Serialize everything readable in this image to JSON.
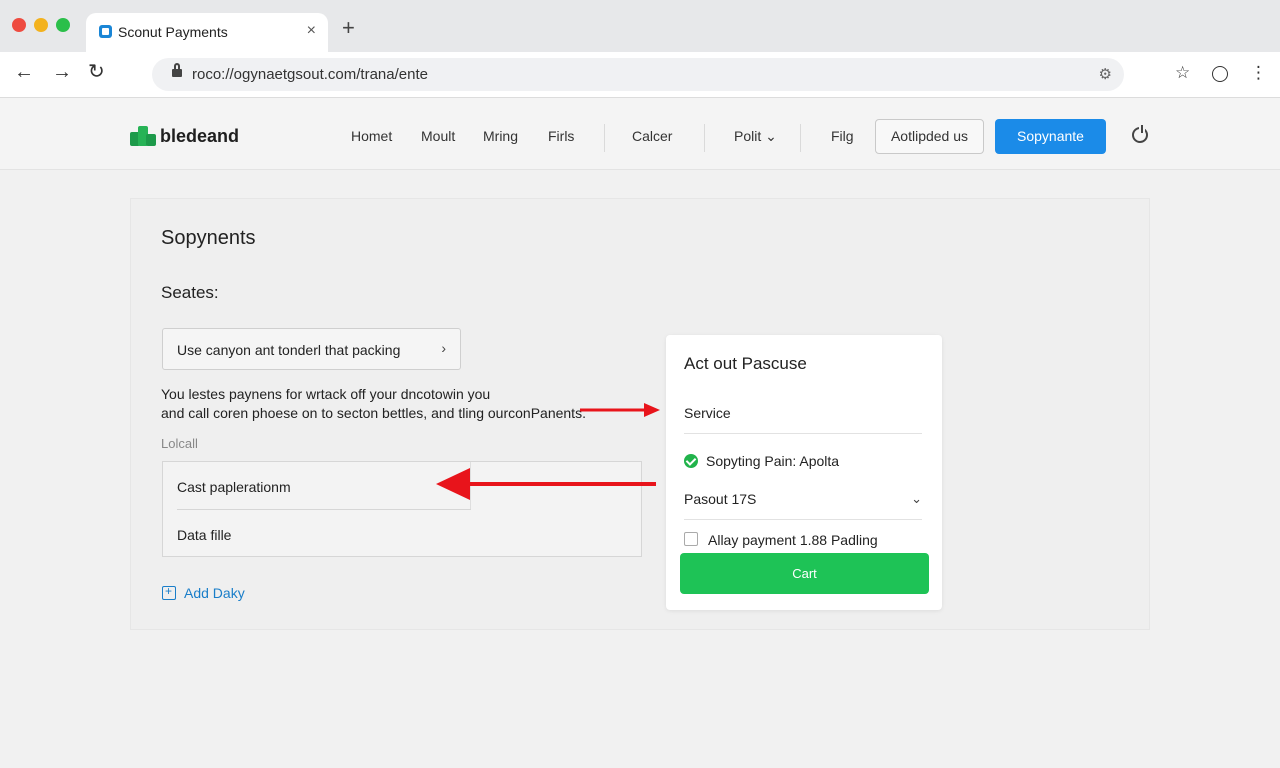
{
  "browser": {
    "tab_title": "Sconut Payments",
    "tab_close": "×",
    "new_tab": "+",
    "back": "←",
    "forward": "→",
    "reload": "↻",
    "url": "roco://ogynaetgsout.com/trana/ente",
    "ext_icon": "⚙",
    "star": "☆",
    "menu": "⋮"
  },
  "header": {
    "logo_text": "bledeand",
    "nav": [
      "Homet",
      "Moult",
      "Mring",
      "Firls",
      "Calcer",
      "Polit",
      "Filg"
    ],
    "polit_chevron": "⌄",
    "outline_button": "Aotlipded us",
    "primary_button": "Sopynante"
  },
  "main": {
    "title": "Sopynents",
    "section_label": "Seates:",
    "select_text": "Use canyon ant tonderl that packing",
    "select_chevron": "›",
    "desc_line1": "You lestes paynens for wrtack off your dncotowin you",
    "desc_line2": "and call coren phoese on to secton bettles, and tling ourconPanents.",
    "small_label": "Lolcall",
    "list_items": [
      "Cast paplerationm",
      "Data fille"
    ],
    "add_link": "Add Daky"
  },
  "card": {
    "title": "Act out Pascuse",
    "service": "Service",
    "status": "Sopyting Pain: Apolta",
    "dropdown": "Pasout 17S",
    "dropdown_chevron": "⌄",
    "checkbox_label": "Allay payment   1.88 Padling",
    "cta": "Cart"
  },
  "colors": {
    "primary": "#1b8be8",
    "cta_green": "#1ec356",
    "annotation_red": "#e8141b",
    "logo_green": "#1d9a4a"
  }
}
